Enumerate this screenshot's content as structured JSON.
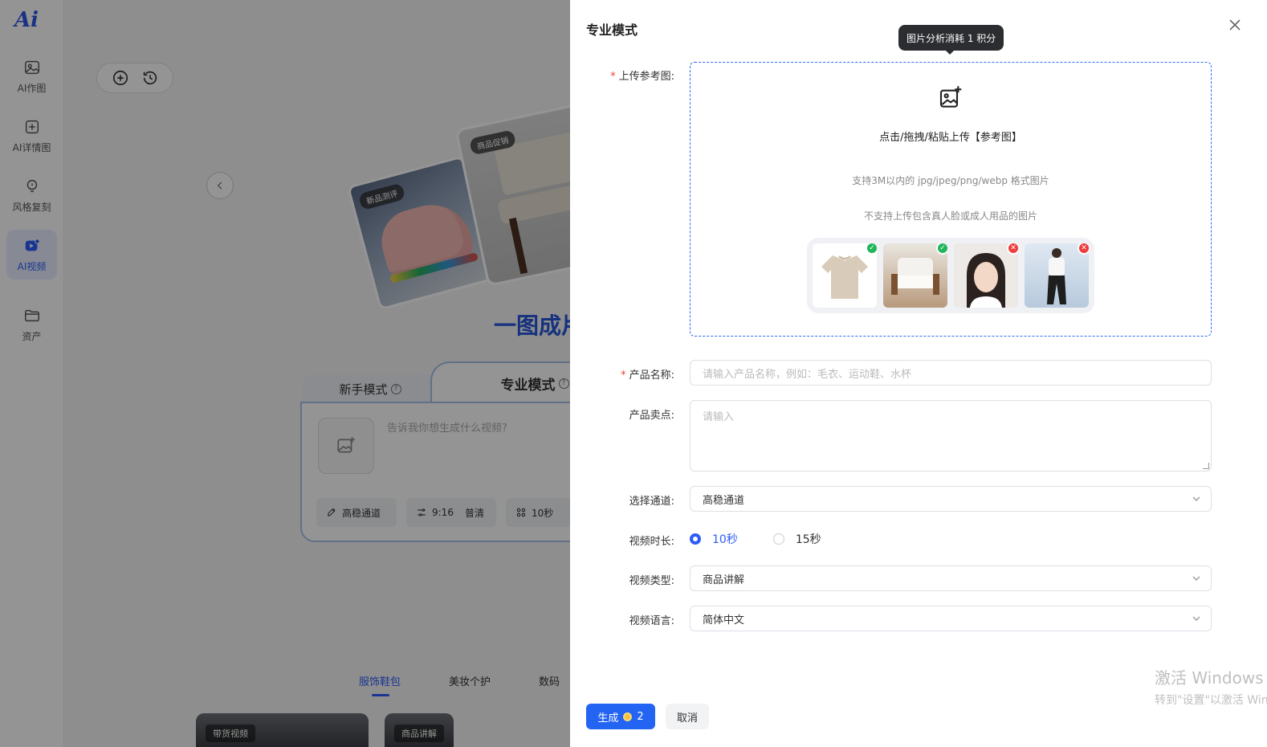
{
  "sidebar": {
    "logo": "Ai",
    "items": [
      {
        "label": "AI作图",
        "icon": "image-icon"
      },
      {
        "label": "AI详情图",
        "icon": "plus-square-icon"
      },
      {
        "label": "风格复刻",
        "icon": "bulb-icon"
      },
      {
        "label": "AI视频",
        "icon": "video-icon"
      },
      {
        "label": "资产",
        "icon": "folder-icon"
      }
    ]
  },
  "background": {
    "card_tags": [
      "新品测评",
      "商品促销"
    ],
    "title": "一图成片",
    "tabs": [
      "新手模式",
      "专业模式"
    ],
    "prompt_placeholder": "告诉我你想生成什么视频?",
    "chips": [
      "高稳通道",
      "9:16",
      "普清",
      "10秒"
    ],
    "categories": [
      "服饰鞋包",
      "美妆个护",
      "数码"
    ],
    "video_tags": [
      "带货视频",
      "商品讲解"
    ]
  },
  "drawer": {
    "title": "专业模式",
    "tooltip": "图片分析消耗 1 积分",
    "upload": {
      "label": "上传参考图:",
      "text": "点击/拖拽/粘贴上传【参考图】",
      "hint1": "支持3M以内的 jpg/jpeg/png/webp 格式图片",
      "hint2": "不支持上传包含真人脸或成人用品的图片"
    },
    "product_name": {
      "label": "产品名称:",
      "placeholder": "请输入产品名称，例如：毛衣、运动鞋、水杯"
    },
    "selling_points": {
      "label": "产品卖点:",
      "placeholder": "请输入"
    },
    "channel": {
      "label": "选择通道:",
      "value": "高稳通道"
    },
    "duration": {
      "label": "视频时长:",
      "options": [
        "10秒",
        "15秒"
      ],
      "selected": "10秒"
    },
    "video_type": {
      "label": "视频类型:",
      "value": "商品讲解"
    },
    "language": {
      "label": "视频语言:",
      "value": "简体中文"
    },
    "generate": {
      "label": "生成",
      "cost": "2"
    },
    "cancel": "取消"
  },
  "watermark": {
    "line1": "激活 Windows",
    "line2": "转到\"设置\"以激活 Windows。"
  },
  "colors": {
    "accent": "#2464f2",
    "danger": "#ef3c3c",
    "success": "#21b55a"
  }
}
